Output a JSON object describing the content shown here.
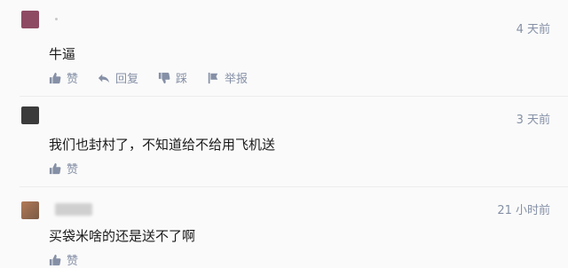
{
  "comments": [
    {
      "time": "4 天前",
      "text": "牛逼",
      "actions": {
        "like": "赞",
        "reply": "回复",
        "dislike": "踩",
        "report": "举报"
      }
    },
    {
      "time": "3 天前",
      "text": "我们也封村了，不知道给不给用飞机送",
      "actions": {
        "like": "赞"
      }
    },
    {
      "time": "21 小时前",
      "text": "买袋米啥的还是送不了啊",
      "actions": {
        "like": "赞"
      }
    }
  ],
  "icons": {
    "like": "thumbs-up-icon",
    "reply": "reply-arrow-icon",
    "dislike": "thumbs-down-icon",
    "report": "flag-icon"
  },
  "colors": {
    "meta": "#8590a6",
    "text": "#1a1a1a",
    "divider": "#ececec"
  }
}
